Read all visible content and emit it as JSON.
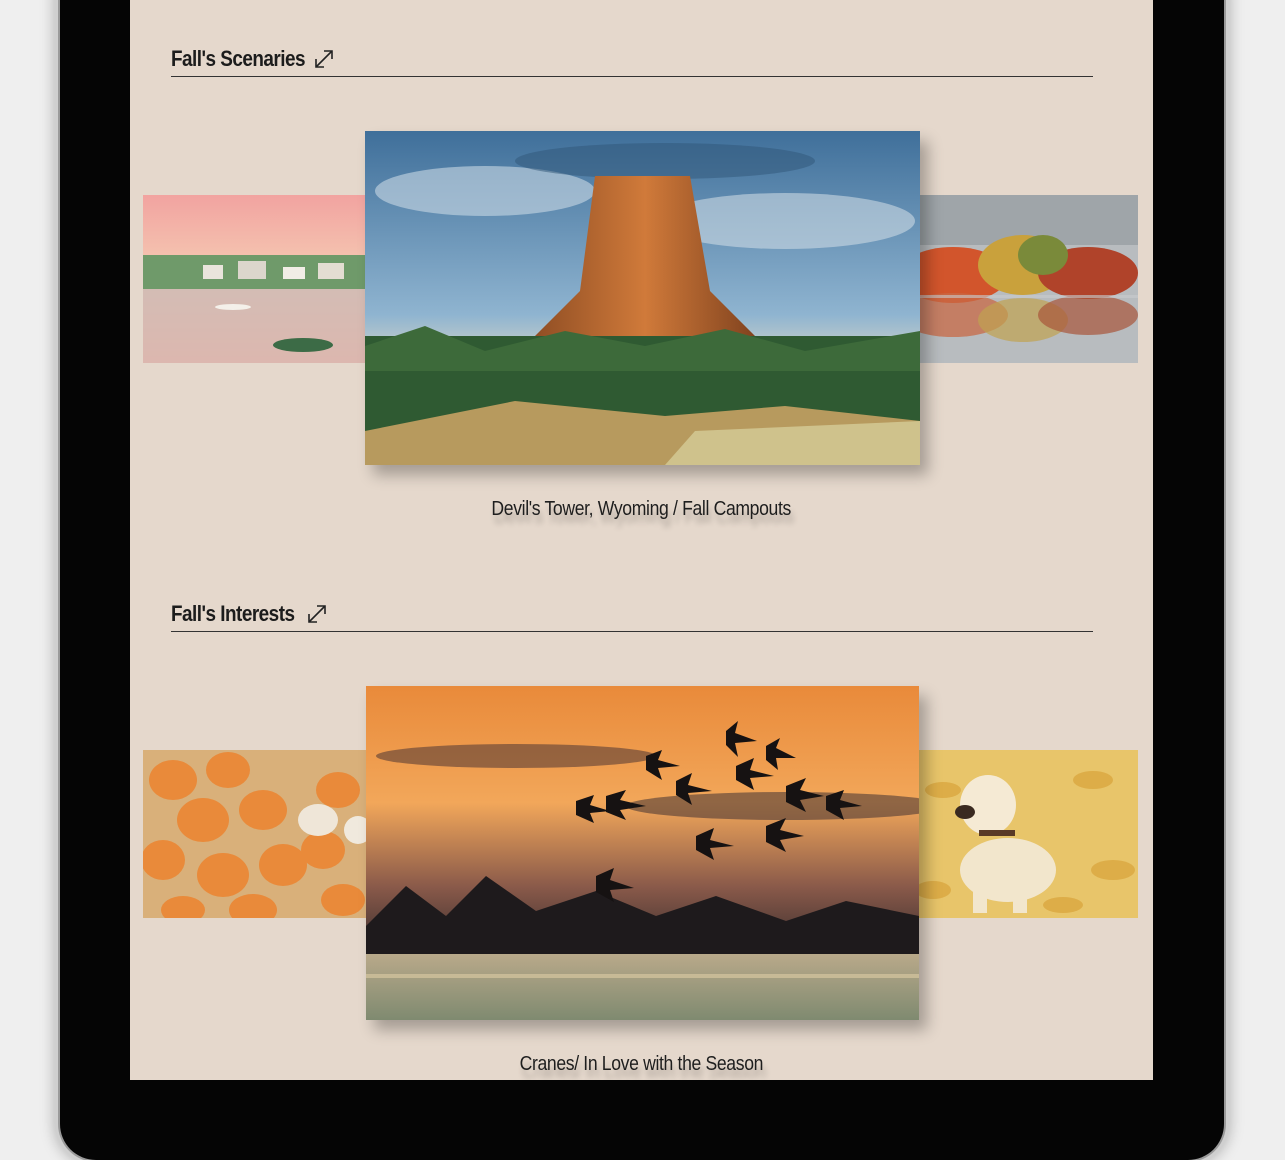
{
  "sections": [
    {
      "title": "Fall's Scenaries",
      "caption": "Devil's Tower, Wyoming / Fall Campouts",
      "images": {
        "left": "Harbor village at sunset",
        "center": "Devil's Tower with pine forest",
        "right": "Autumn trees reflected in lake"
      }
    },
    {
      "title": "Fall's Interests",
      "caption": "Cranes/ In Love with the Season",
      "images": {
        "left": "Pile of pumpkins",
        "center": "Cranes flying at sunset",
        "right": "Labrador puppy in autumn leaves"
      }
    }
  ],
  "colors": {
    "page_bg": "#e5d8cc",
    "frame": "#050505",
    "text": "#1c1c1c"
  },
  "icons": [
    "expand-icon"
  ]
}
